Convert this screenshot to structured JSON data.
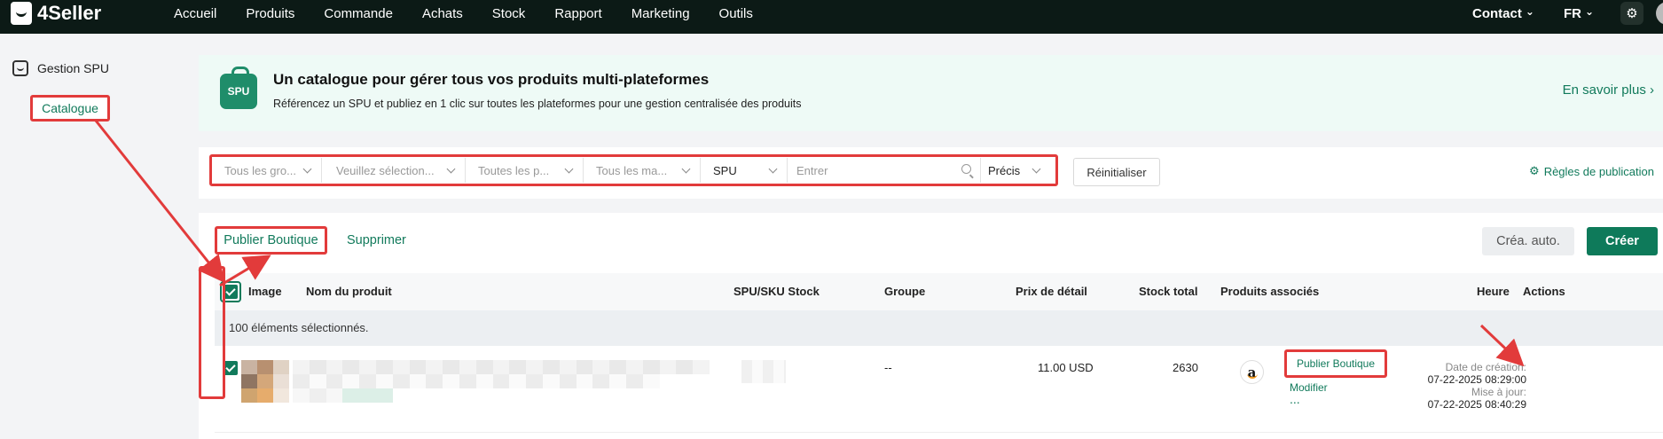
{
  "app": {
    "logo": "4Seller"
  },
  "nav": {
    "items": [
      "Accueil",
      "Produits",
      "Commande",
      "Achats",
      "Stock",
      "Rapport",
      "Marketing",
      "Outils"
    ],
    "contact": "Contact",
    "lang": "FR"
  },
  "sidebar": {
    "section": "Gestion SPU",
    "active_item": "Catalogue"
  },
  "banner": {
    "badge": "SPU",
    "title": "Un catalogue pour gérer tous vos produits multi-plateformes",
    "subtitle": "Référencez un SPU et publiez en 1 clic sur toutes les plateformes pour une gestion centralisée des produits",
    "link": "En savoir plus"
  },
  "filters": {
    "group_placeholder": "Tous les gro...",
    "select_placeholder": "Veuillez sélection...",
    "platform_placeholder": "Toutes les p...",
    "brand_placeholder": "Tous les ma...",
    "search_type": "SPU",
    "search_placeholder": "Entrer",
    "match_mode": "Précis",
    "reset_label": "Réinitialiser",
    "rules_link": "Règles de publication"
  },
  "toolbar": {
    "publish_shop": "Publier Boutique",
    "delete": "Supprimer",
    "auto_create": "Créa. auto.",
    "create": "Créer"
  },
  "table": {
    "headers": {
      "image": "Image",
      "name": "Nom du produit",
      "spu_sku": "SPU/SKU Stock",
      "group": "Groupe",
      "price": "Prix de détail",
      "stock": "Stock total",
      "linked": "Produits associés",
      "time": "Heure",
      "actions": "Actions"
    },
    "selection_text": "100 éléments sélectionnés.",
    "rows": [
      {
        "group": "--",
        "price": "11.00 USD",
        "stock": "2630",
        "linked_platform": "amazon-icon",
        "created_label": "Date de création:",
        "created": "07-22-2025 08:29:00",
        "updated_label": "Mise à jour:",
        "updated": "07-22-2025 08:40:29",
        "actions": {
          "publish": "Publier Boutique",
          "modify": "Modifier",
          "more": "..."
        }
      }
    ]
  },
  "colors": {
    "brand": "#117a5b",
    "highlight": "#e23b3b",
    "topbar": "#0c1a16"
  }
}
